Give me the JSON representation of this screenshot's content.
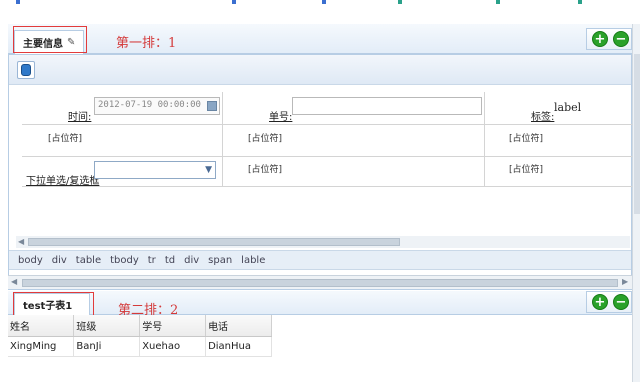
{
  "section1": {
    "tab_label": "主要信息",
    "annotation": "第一排：1",
    "add_button": "+",
    "remove_button": "−"
  },
  "form": {
    "time_label": "时间:",
    "time_value": "2012-07-19 00:00:00",
    "order_label": "单号:",
    "tag_label": "标签:",
    "tag_value": "label",
    "placeholder": "[占位符]",
    "dropdown_label": "下拉单选/复选框",
    "dropdown_value": ""
  },
  "path_items": [
    "body",
    "div",
    "table",
    "tbody",
    "tr",
    "td",
    "div",
    "span",
    "lable"
  ],
  "section2": {
    "tab_label": "test子表1",
    "annotation": "第二排：2",
    "add_button": "+",
    "remove_button": "−"
  },
  "subtable": {
    "headers": [
      "姓名",
      "班级",
      "学号",
      "电话"
    ],
    "rows": [
      [
        "XingMing",
        "BanJi",
        "Xuehao",
        "DianHua"
      ]
    ]
  },
  "colors": {
    "annotation_red": "#d43a3a",
    "add_green": "#2aa12a",
    "header_blue": "#e3edf8"
  }
}
